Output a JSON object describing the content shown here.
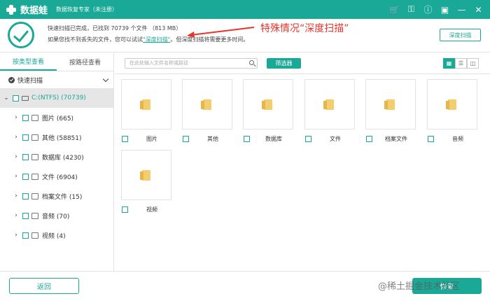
{
  "titlebar": {
    "app_name": "数据蛙",
    "app_subtitle": "数据恢复专家（未注册）",
    "icons": [
      "cart-icon",
      "key-icon",
      "help-icon",
      "save-icon",
      "minimize-icon",
      "close-icon"
    ]
  },
  "status": {
    "line1_prefix": "快速扫描已完成，已找到 ",
    "file_count": "70739",
    "line1_mid": " 个文件 （",
    "size": "813 MB",
    "line1_suffix": "）",
    "line2_prefix": "如果您找不到丢失的文件，您可以试试",
    "deep_link": "\"深度扫描\"",
    "line2_suffix": "。但深度扫描将需要更多时间。",
    "annotation": "特殊情况“深度扫描”",
    "deep_scan_button": "深度扫描"
  },
  "sidebar": {
    "tabs": [
      {
        "label": "按类型查看",
        "active": true
      },
      {
        "label": "按路径查看",
        "active": false
      }
    ],
    "quick_scan_label": "快速扫描",
    "drive_label": "C:(NTFS) (70739)",
    "nodes": [
      {
        "label": "图片 (665)",
        "icon": "image-icon"
      },
      {
        "label": "其他 (58851)",
        "icon": "folder-icon"
      },
      {
        "label": "数据库 (4230)",
        "icon": "database-icon"
      },
      {
        "label": "文件 (6904)",
        "icon": "document-icon"
      },
      {
        "label": "档案文件 (15)",
        "icon": "archive-icon"
      },
      {
        "label": "音频 (70)",
        "icon": "audio-icon"
      },
      {
        "label": "视频 (4)",
        "icon": "video-icon"
      }
    ]
  },
  "toolbar": {
    "search_placeholder": "在此处输入文件名称或路径",
    "filter_button": "筛选器",
    "view_modes": [
      "grid-view-icon",
      "list-view-icon",
      "detail-view-icon"
    ]
  },
  "cards": [
    {
      "label": "图片"
    },
    {
      "label": "其他"
    },
    {
      "label": "数据库"
    },
    {
      "label": "文件"
    },
    {
      "label": "档案文件"
    },
    {
      "label": "音频"
    },
    {
      "label": "视频"
    }
  ],
  "footer": {
    "back_button": "返回",
    "recover_button": "恢复",
    "watermark": "@稀土掘金技术社区"
  },
  "colors": {
    "accent": "#1aa897",
    "annotation": "#e8352c",
    "folder": "#f3cd6e"
  }
}
